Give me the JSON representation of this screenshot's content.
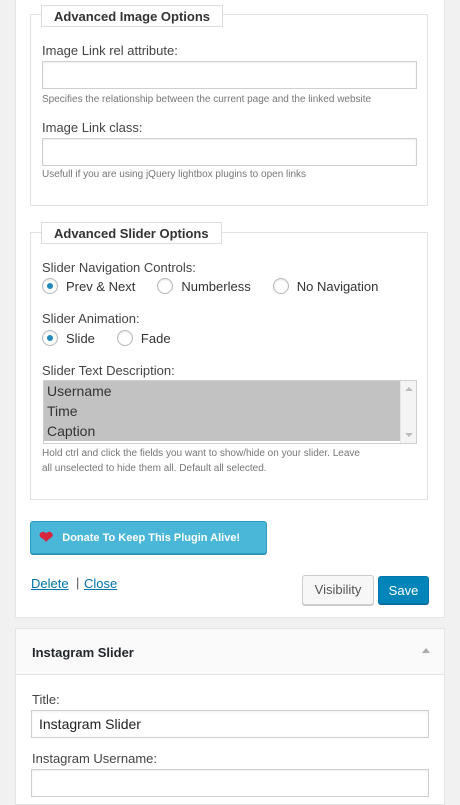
{
  "image_options": {
    "legend": "Advanced Image Options",
    "rel_label": "Image Link rel attribute:",
    "rel_value": "",
    "rel_hint": "Specifies the relationship between the current page and the linked website",
    "class_label": "Image Link class:",
    "class_value": "",
    "class_hint": "Usefull if you are using jQuery lightbox plugins to open links"
  },
  "slider_options": {
    "legend": "Advanced Slider Options",
    "nav_label": "Slider Navigation Controls:",
    "nav_options": [
      {
        "label": "Prev & Next",
        "checked": true
      },
      {
        "label": "Numberless",
        "checked": false
      },
      {
        "label": "No Navigation",
        "checked": false
      }
    ],
    "anim_label": "Slider Animation:",
    "anim_options": [
      {
        "label": "Slide",
        "checked": true
      },
      {
        "label": "Fade",
        "checked": false
      }
    ],
    "text_label": "Slider Text Description:",
    "text_options": [
      "Username",
      "Time",
      "Caption"
    ],
    "text_hint_line1": "Hold ctrl and click the fields you want to show/hide on your slider. Leave",
    "text_hint_line2": "all unselected to hide them all. Default all selected."
  },
  "donate": {
    "label": "Donate To Keep This Plugin Alive!"
  },
  "actions": {
    "delete_label": "Delete",
    "separator": "|",
    "close_label": "Close",
    "visibility_label": "Visibility",
    "save_label": "Save"
  },
  "widget2": {
    "title": "Instagram Slider",
    "title_label": "Title:",
    "title_value": "Instagram Slider",
    "username_label": "Instagram Username:",
    "username_value": ""
  }
}
